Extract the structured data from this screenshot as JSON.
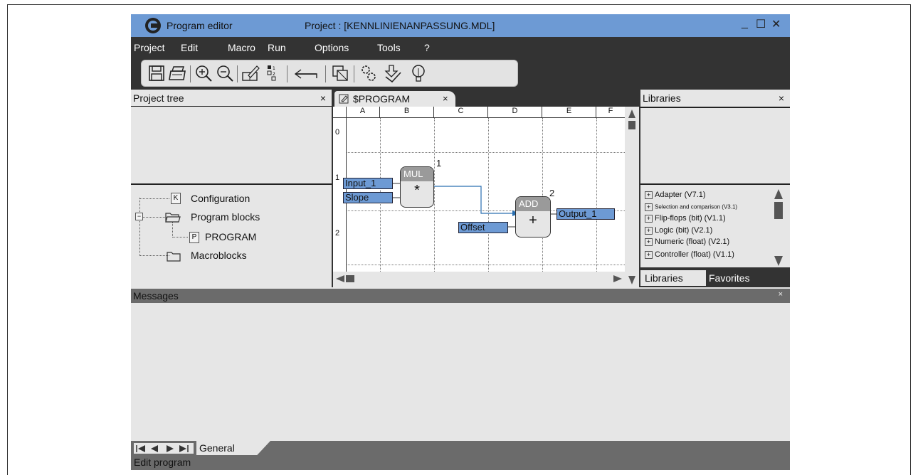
{
  "window": {
    "title": "Program editor",
    "project": "Project : [KENNLINIENANPASSUNG.MDL]"
  },
  "window_buttons": {
    "minimize": "_",
    "maximize": "☐",
    "close": "✕"
  },
  "menu": [
    "Project",
    "Edit",
    "Macro",
    "Run",
    "Options",
    "Tools",
    "?"
  ],
  "toolbar_icons": [
    "save-icon",
    "print-icon",
    "zoom-in-icon",
    "zoom-out-icon",
    "edit-block-icon",
    "numbering-icon",
    "undo-icon",
    "copy-block-icon",
    "settings-icon",
    "download-icon",
    "bulb-icon"
  ],
  "project_tree": {
    "title": "Project tree",
    "close": "×",
    "items": [
      {
        "badge": "K",
        "label": "Configuration"
      },
      {
        "badge": "",
        "label": "Program blocks"
      },
      {
        "badge": "P",
        "label": "PROGRAM"
      },
      {
        "badge": "",
        "label": "Macroblocks"
      }
    ]
  },
  "editor": {
    "tab_label": "$PROGRAM",
    "tab_close": "×",
    "columns": [
      "A",
      "B",
      "C",
      "D",
      "E",
      "F"
    ],
    "rows": [
      "0",
      "1",
      "2"
    ],
    "signals": {
      "input_1": "Input_1",
      "slope": "Slope",
      "offset": "Offset",
      "output_1": "Output_1"
    },
    "blocks": {
      "mul": {
        "name": "MUL",
        "symbol": "*",
        "number": "1"
      },
      "add": {
        "name": "ADD",
        "symbol": "+",
        "number": "2"
      }
    }
  },
  "libraries": {
    "title": "Libraries",
    "close": "×",
    "items": [
      "Adapter (V7.1)",
      "Selection and comparison (V3.1)",
      "Flip-flops (bit) (V1.1)",
      "Logic (bit) (V2.1)",
      "Numeric (float) (V2.1)",
      "Controller (float) (V1.1)"
    ],
    "tabs": [
      "Libraries",
      "Favorites"
    ]
  },
  "messages": {
    "title": "Messages",
    "close": "×",
    "tab": "General"
  },
  "status": {
    "text": "Edit program"
  },
  "colors": {
    "accent": "#6d9ad4",
    "dark": "#333333",
    "panel": "#e6e6e6",
    "status": "#6b6b6b"
  }
}
